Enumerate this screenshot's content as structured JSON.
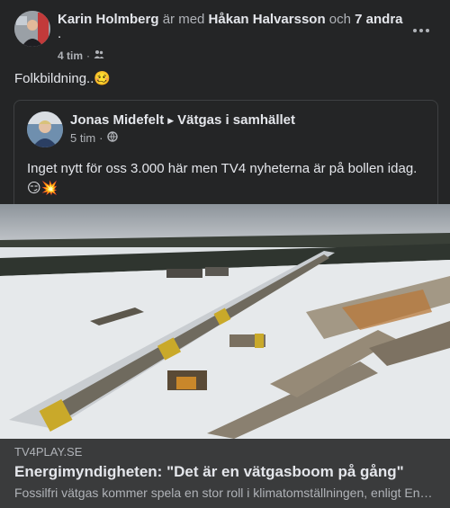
{
  "post": {
    "author": "Karin Holmberg",
    "with_text": "är med",
    "tagged_person": "Håkan Halvarsson",
    "and_text": "och",
    "others": "7 andra",
    "trailing_dot": ".",
    "time": "4 tim",
    "separator": "·",
    "audience_icon": "friends-icon",
    "text": "Folkbildning..🥴"
  },
  "shared_post": {
    "author": "Jonas Midefelt",
    "arrow": "▶",
    "group": "Vätgas i samhället",
    "time": "5 tim",
    "separator": "·",
    "audience_icon": "globe-icon",
    "text": "Inget nytt för oss 3.000 här men TV4 nyheterna är på bollen idag. 😏💥"
  },
  "link": {
    "domain": "TV4PLAY.SE",
    "title": "Energimyndigheten: \"Det är en vätgasboom på gång\"",
    "description": "Fossilfri vätgas kommer spela en stor roll i klimatomställningen, enligt Energimyndigheten."
  },
  "colors": {
    "background": "#242526",
    "card": "#3a3b3c",
    "text_primary": "#e4e6eb",
    "text_secondary": "#b0b3b8"
  }
}
